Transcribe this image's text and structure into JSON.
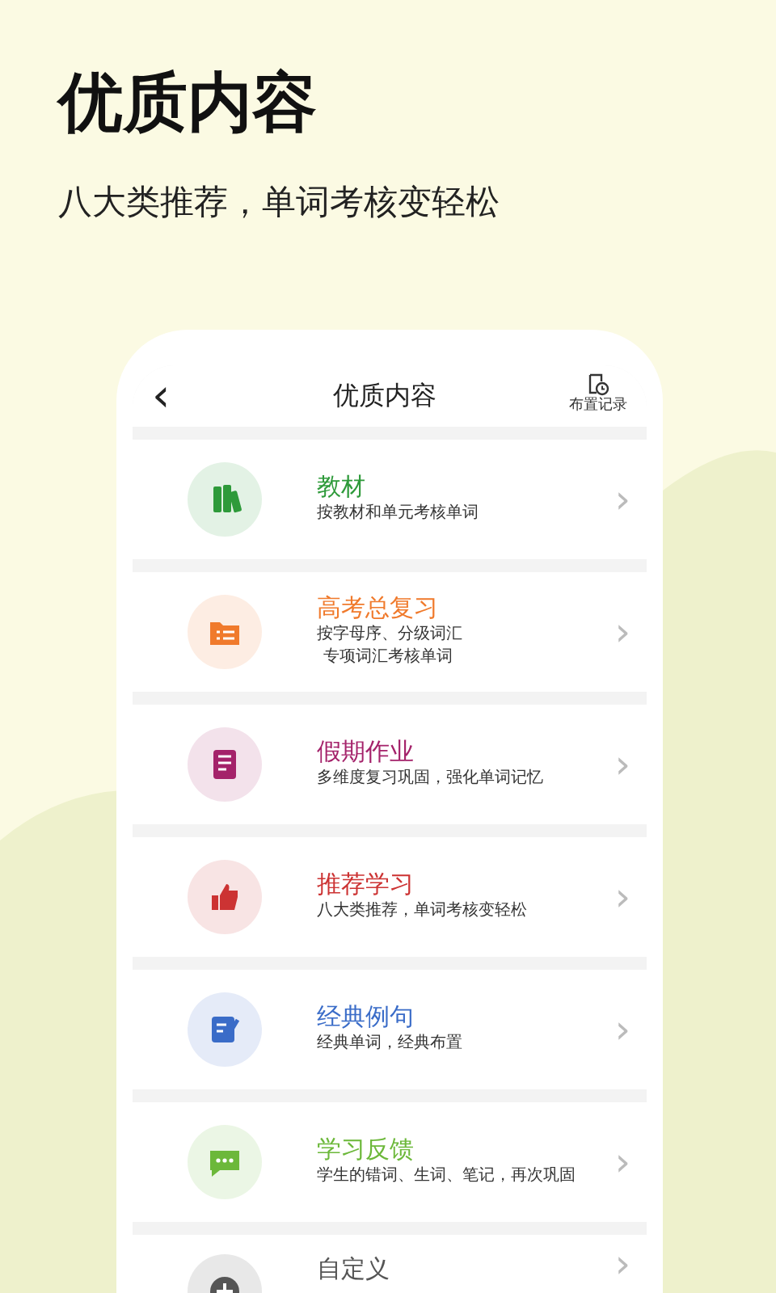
{
  "headline": "优质内容",
  "tagline": "八大类推荐，单词考核变轻松",
  "phone": {
    "back": "‹",
    "title": "优质内容",
    "action": "布置记录",
    "items": [
      {
        "kind": "books",
        "title": "教材",
        "color": "#2e9a3a",
        "lines": [
          "按教材和单元考核单词"
        ],
        "chevron": "›"
      },
      {
        "kind": "folder",
        "title": "高考总复习",
        "color": "#f07a2c",
        "lines": [
          "按字母序、分级词汇",
          "专项词汇考核单词"
        ],
        "chevron": "›"
      },
      {
        "kind": "form",
        "title": "假期作业",
        "color": "#a4226a",
        "lines": [
          "多维度复习巩固，强化单词记忆"
        ],
        "chevron": "›"
      },
      {
        "kind": "thumb",
        "title": "推荐学习",
        "color": "#cc3333",
        "lines": [
          "八大类推荐，单词考核变轻松"
        ],
        "chevron": "›"
      },
      {
        "kind": "note",
        "title": "经典例句",
        "color": "#3a6cc8",
        "lines": [
          "经典单词，经典布置"
        ],
        "chevron": "›"
      },
      {
        "kind": "chat",
        "title": "学习反馈",
        "color": "#6cb83a",
        "lines": [
          "学生的错词、生词、笔记，再次巩固"
        ],
        "chevron": "›"
      },
      {
        "kind": "plus",
        "title": "自定义",
        "color": "#555555",
        "chevron": "›"
      }
    ]
  }
}
